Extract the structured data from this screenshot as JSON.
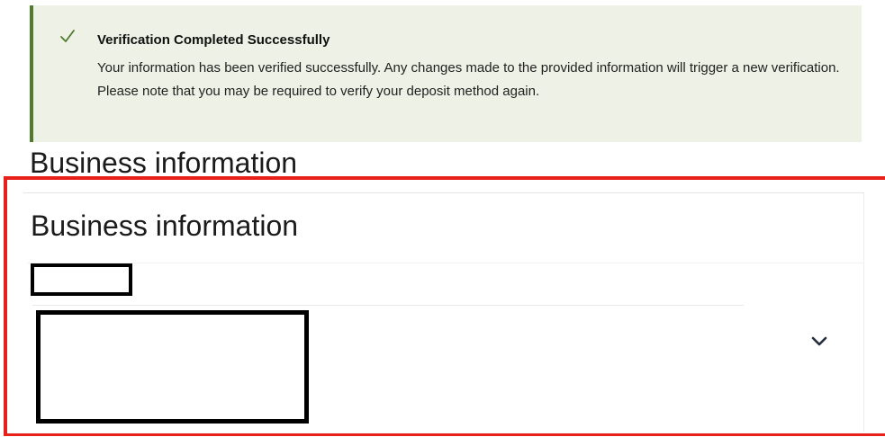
{
  "alert": {
    "icon": "check-icon",
    "title": "Verification Completed Successfully",
    "message": "Your information has been verified successfully. Any changes made to the provided information will trigger a new verification. Please note that you may be required to verify your deposit method again.",
    "colors": {
      "background": "#eef1e5",
      "accent": "#4f7a2f"
    }
  },
  "page": {
    "heading": "Business information"
  },
  "section": {
    "title": "Business information",
    "highlight_color": "#e8201c",
    "field": {
      "label": "",
      "value": "",
      "dropdown_icon": "chevron-down-icon"
    }
  }
}
